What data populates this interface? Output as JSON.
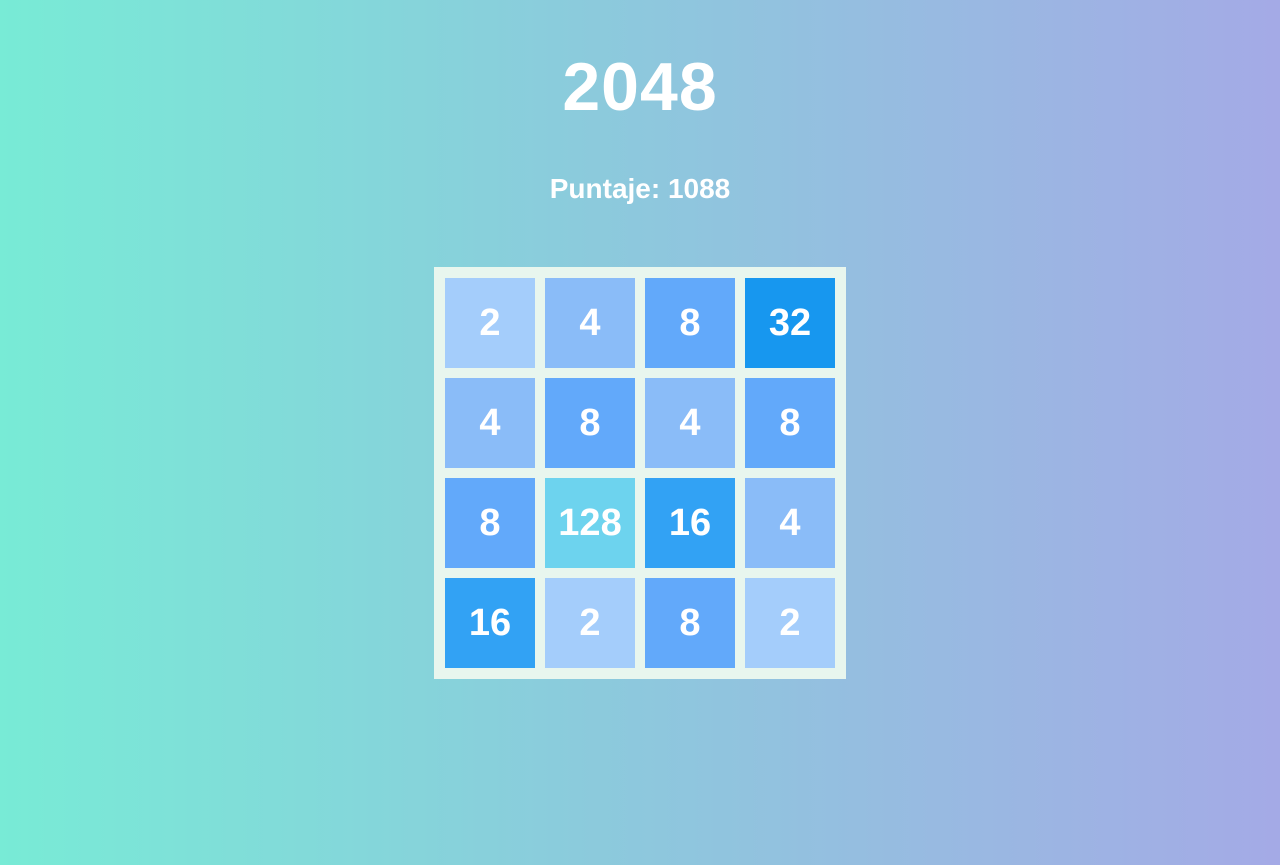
{
  "title": "2048",
  "score_label": "Puntaje: 1088",
  "board": {
    "rows": [
      [
        "2",
        "4",
        "8",
        "32"
      ],
      [
        "4",
        "8",
        "4",
        "8"
      ],
      [
        "8",
        "128",
        "16",
        "4"
      ],
      [
        "16",
        "2",
        "8",
        "2"
      ]
    ]
  },
  "colors": {
    "background_left": "#78ebd6",
    "background_right": "#a4aae6",
    "board_background": "#e8f6ee",
    "tile_2": "#a4cdfb",
    "tile_4": "#8abcf8",
    "tile_8": "#62a9fa",
    "tile_16": "#32a2f4",
    "tile_32": "#1797ef",
    "tile_128": "#6dd3ee"
  }
}
